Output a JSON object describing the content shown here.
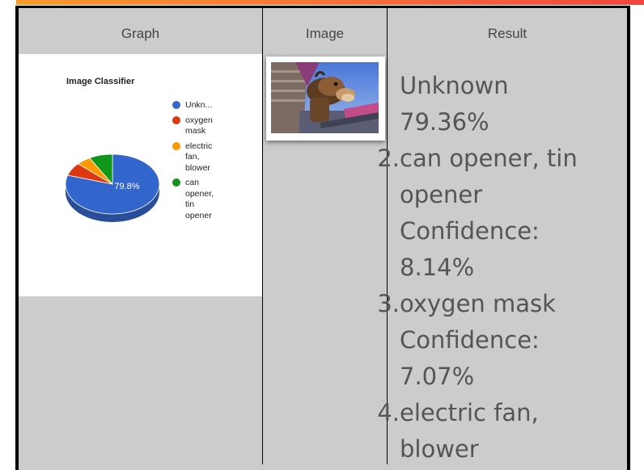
{
  "table": {
    "headers": {
      "graph": "Graph",
      "image": "Image",
      "result": "Result"
    }
  },
  "chart": {
    "title": "Image Classifier",
    "slice_label": "79.8%",
    "legend": [
      {
        "label": "Unkn...",
        "color": "#3366cc"
      },
      {
        "label": "oxygen mask",
        "color": "#dc3912"
      },
      {
        "label": "electric fan, blower",
        "color": "#ff9900"
      },
      {
        "label": "can opener, tin opener",
        "color": "#109618"
      }
    ]
  },
  "chart_data": {
    "type": "pie",
    "title": "Image Classifier",
    "categories": [
      "Unknown",
      "oxygen mask",
      "electric fan, blower",
      "can opener, tin opener"
    ],
    "values": [
      79.8,
      7.1,
      5.0,
      8.1
    ],
    "colors": [
      "#3366cc",
      "#dc3912",
      "#ff9900",
      "#109618"
    ],
    "data_labels": [
      "79.8%",
      "",
      "",
      ""
    ],
    "legend_placement": "right"
  },
  "image": {
    "icon": "camel-photo-thumbnail"
  },
  "results": [
    {
      "num": "",
      "lines": [
        "Unknown",
        "79.36%"
      ]
    },
    {
      "num": "2.",
      "lines": [
        "can opener, tin",
        "opener",
        "Confidence:",
        "8.14%"
      ]
    },
    {
      "num": "3.",
      "lines": [
        "oxygen mask",
        "Confidence:",
        "7.07%"
      ]
    },
    {
      "num": "4.",
      "lines": [
        "electric fan,",
        "blower"
      ]
    }
  ]
}
